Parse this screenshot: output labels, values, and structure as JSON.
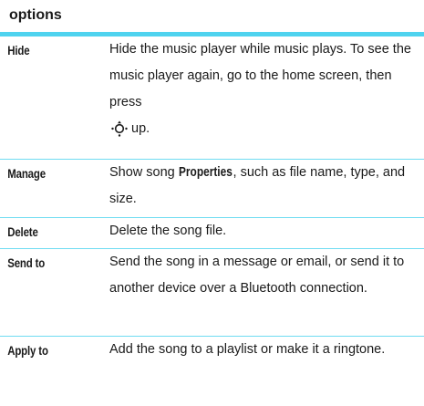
{
  "header": {
    "title": "options"
  },
  "rows": [
    {
      "term": "Hide",
      "desc_before": "Hide the music player while music plays. To see the music player again, go to the home screen, then press",
      "desc_after": "up.",
      "icon": "nav-key-icon"
    },
    {
      "term": "Manage",
      "desc_before": "Show song",
      "desc_key": "Properties",
      "desc_after": ", such as file name, type, and size."
    },
    {
      "term": "Delete",
      "desc": "Delete the song file."
    },
    {
      "term": "Send to",
      "desc": "Send the song in a message or email, or send it to another device over a Bluetooth connection."
    },
    {
      "term": "Apply to",
      "desc": "Add the song to a playlist or make it a ringtone."
    }
  ],
  "colors": {
    "accent": "#4fd3ef",
    "divider": "#6fdcf2",
    "text": "#1a1a1a"
  }
}
